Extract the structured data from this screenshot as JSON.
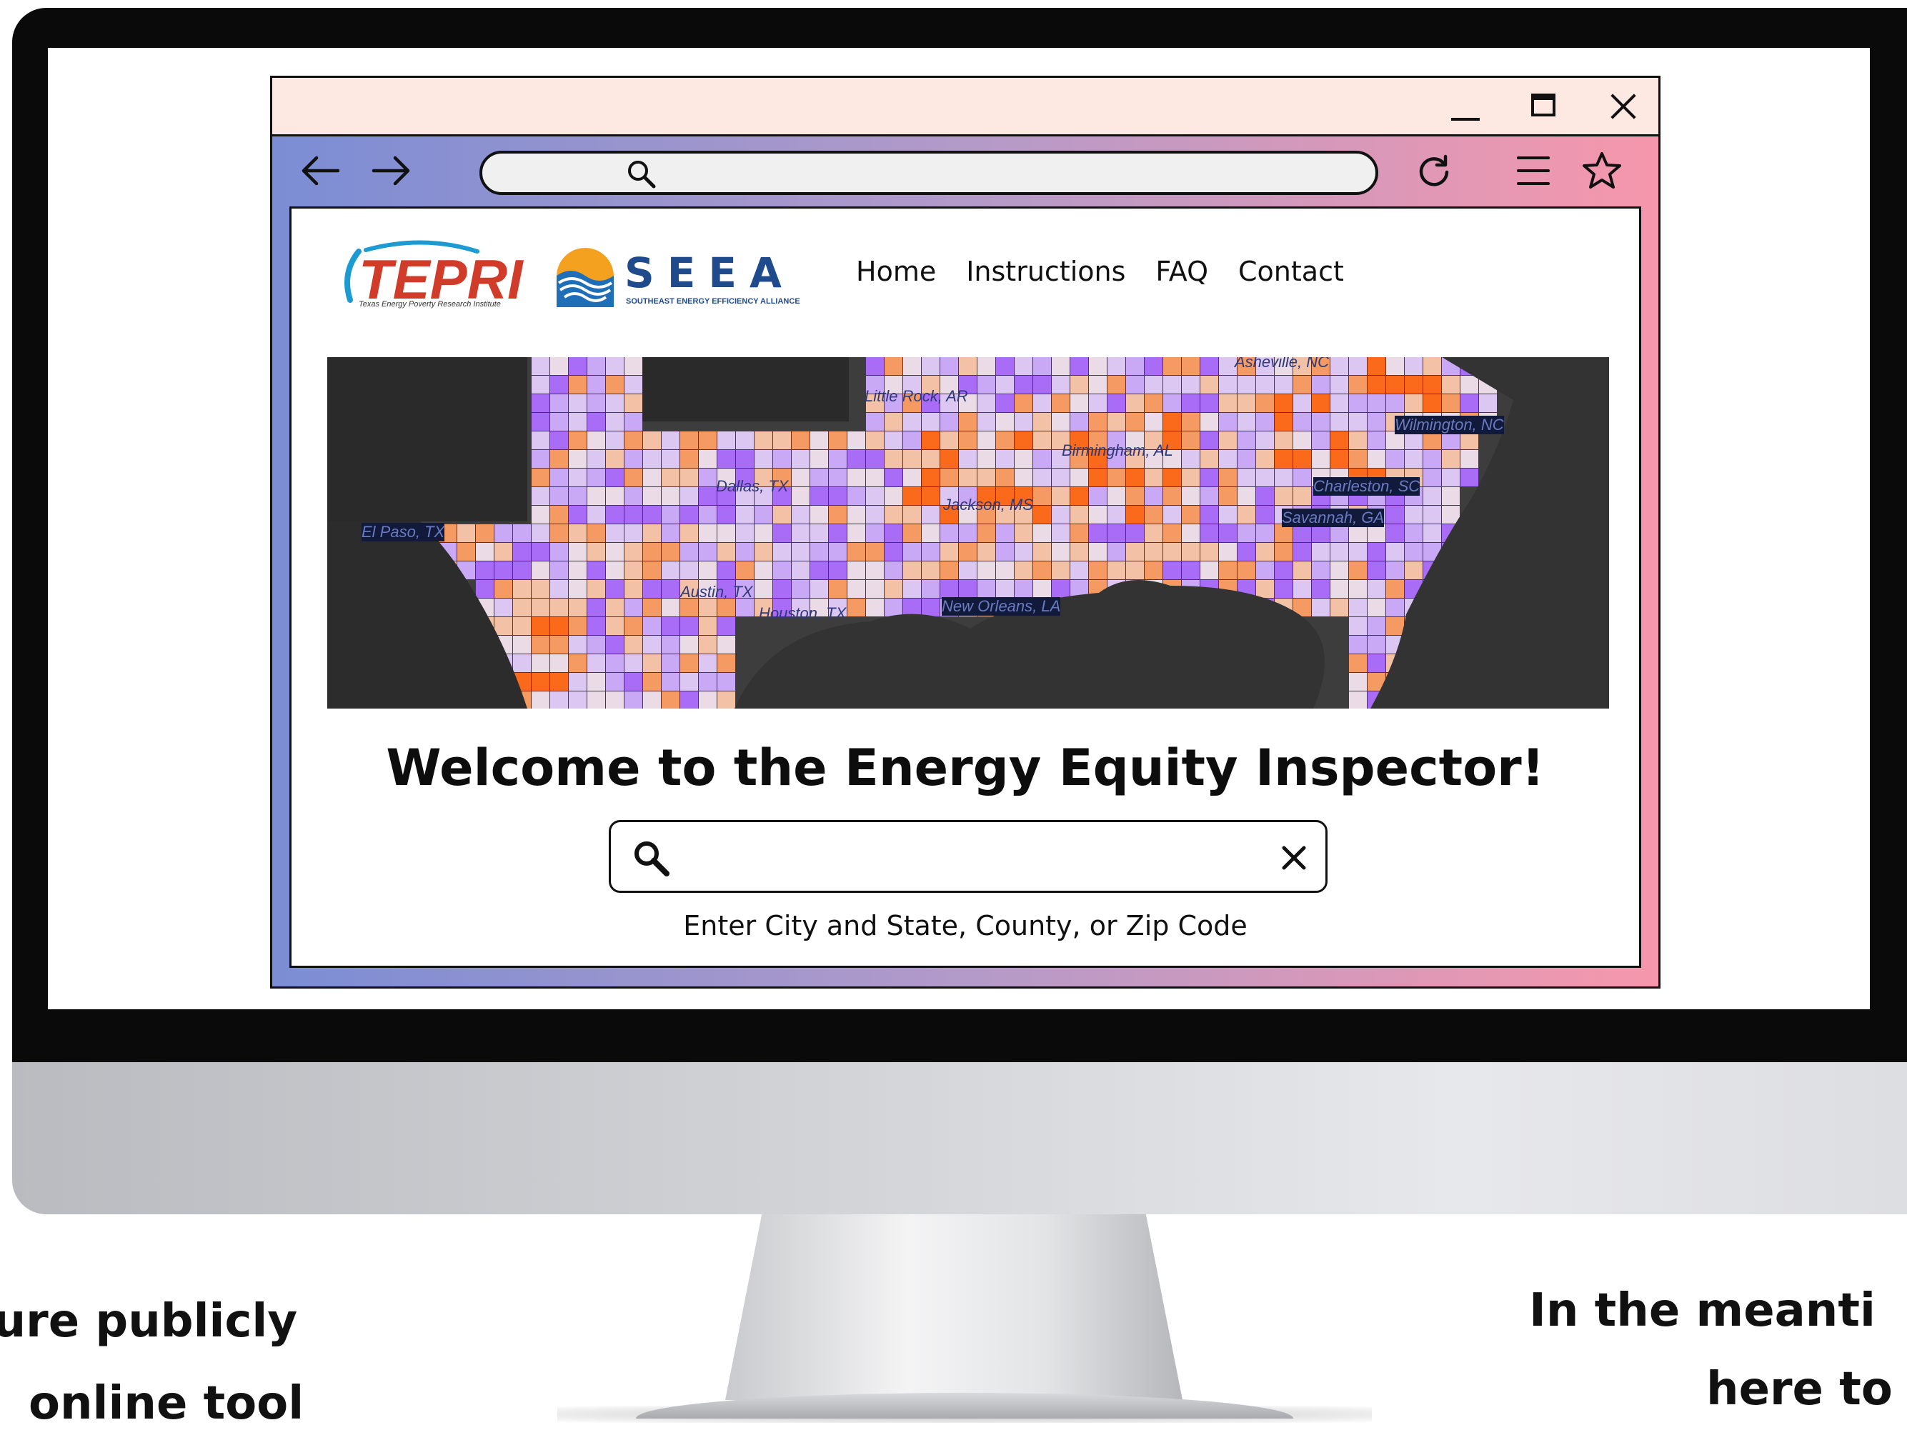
{
  "captions": {
    "left_line1": "ture publicly",
    "left_line2": "online tool",
    "right_line1": "In the meanti",
    "right_line2": "here to"
  },
  "browser": {
    "window_controls": [
      "minimize-icon",
      "maximize-icon",
      "close-icon"
    ],
    "toolbar_icons": [
      "arrow-left-icon",
      "arrow-right-icon",
      "search-icon",
      "reload-icon",
      "menu-icon",
      "star-icon"
    ],
    "colors": {
      "titlebar": "#fde8e2",
      "frame_left": "#7b8dd4",
      "frame_right": "#f697ac"
    }
  },
  "header": {
    "logo_tepri": {
      "text": "TEPRI",
      "subtitle": "Texas Energy Poverty Research Institute"
    },
    "logo_seea": {
      "text": "SEEA",
      "subtitle": "SOUTHEAST ENERGY EFFICIENCY ALLIANCE"
    },
    "nav": [
      "Home",
      "Instructions",
      "FAQ",
      "Contact"
    ]
  },
  "map": {
    "cities": [
      "Asheville, NC",
      "Little Rock, AR",
      "Wilmington, NC",
      "Birmingham, AL",
      "Dallas, TX",
      "Charleston, SC",
      "Jackson, MS",
      "Savannah, GA",
      "El Paso, TX",
      "Austin, TX",
      "Houston, TX",
      "New Orleans, LA"
    ],
    "colors": {
      "background": "#3d3d3d",
      "low": "#a86cf6",
      "mid": "#eadbe6",
      "high": "#fb6a1a"
    }
  },
  "main": {
    "welcome_title": "Welcome to the Energy Equity Inspector!",
    "search_value": "",
    "search_hint": "Enter City and State, County, or Zip Code"
  }
}
